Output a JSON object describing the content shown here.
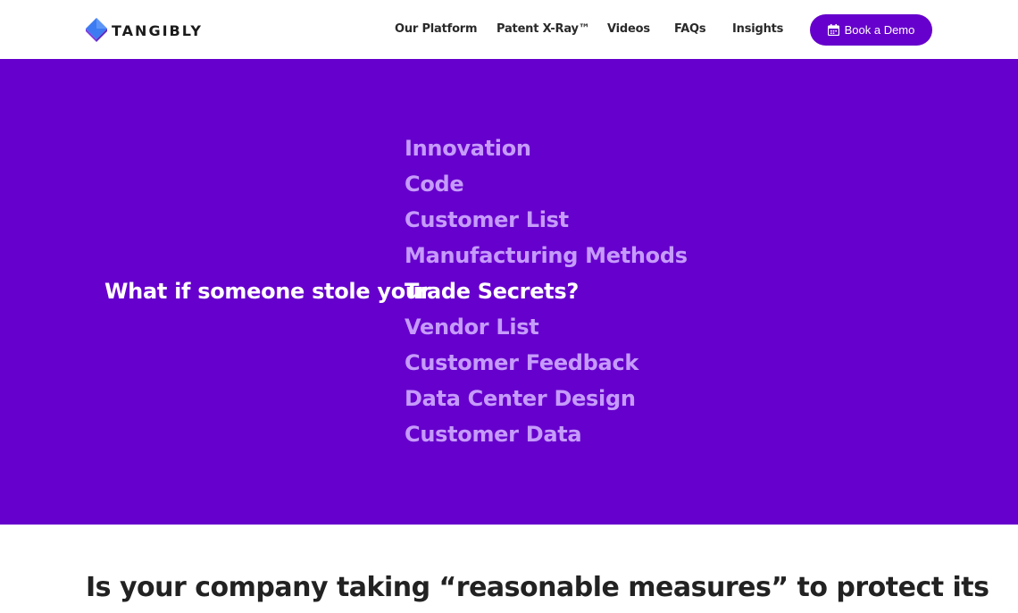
{
  "brand": {
    "name": "TANGIBLY",
    "logo_icon": "diamond-logo-icon",
    "accent": "#6600cc"
  },
  "nav": {
    "items": [
      {
        "label": "Our Platform"
      },
      {
        "label": "Patent X-Ray™"
      },
      {
        "label": "Videos"
      },
      {
        "label": "FAQs"
      },
      {
        "label": "Insights"
      }
    ],
    "cta": {
      "label": "Book a Demo",
      "icon": "calendar-icon"
    }
  },
  "hero": {
    "background": "#6600cc",
    "question": "What if someone stole your",
    "secrets": [
      "Innovation",
      "Code",
      "Customer List",
      "Manufacturing Methods",
      "Trade Secrets?",
      "Vendor List",
      "Customer Feedback",
      "Data Center Design",
      "Customer Data"
    ],
    "active_secret": "Trade Secrets?"
  },
  "section": {
    "heading": "Is your company taking “reasonable measures” to protect its"
  }
}
